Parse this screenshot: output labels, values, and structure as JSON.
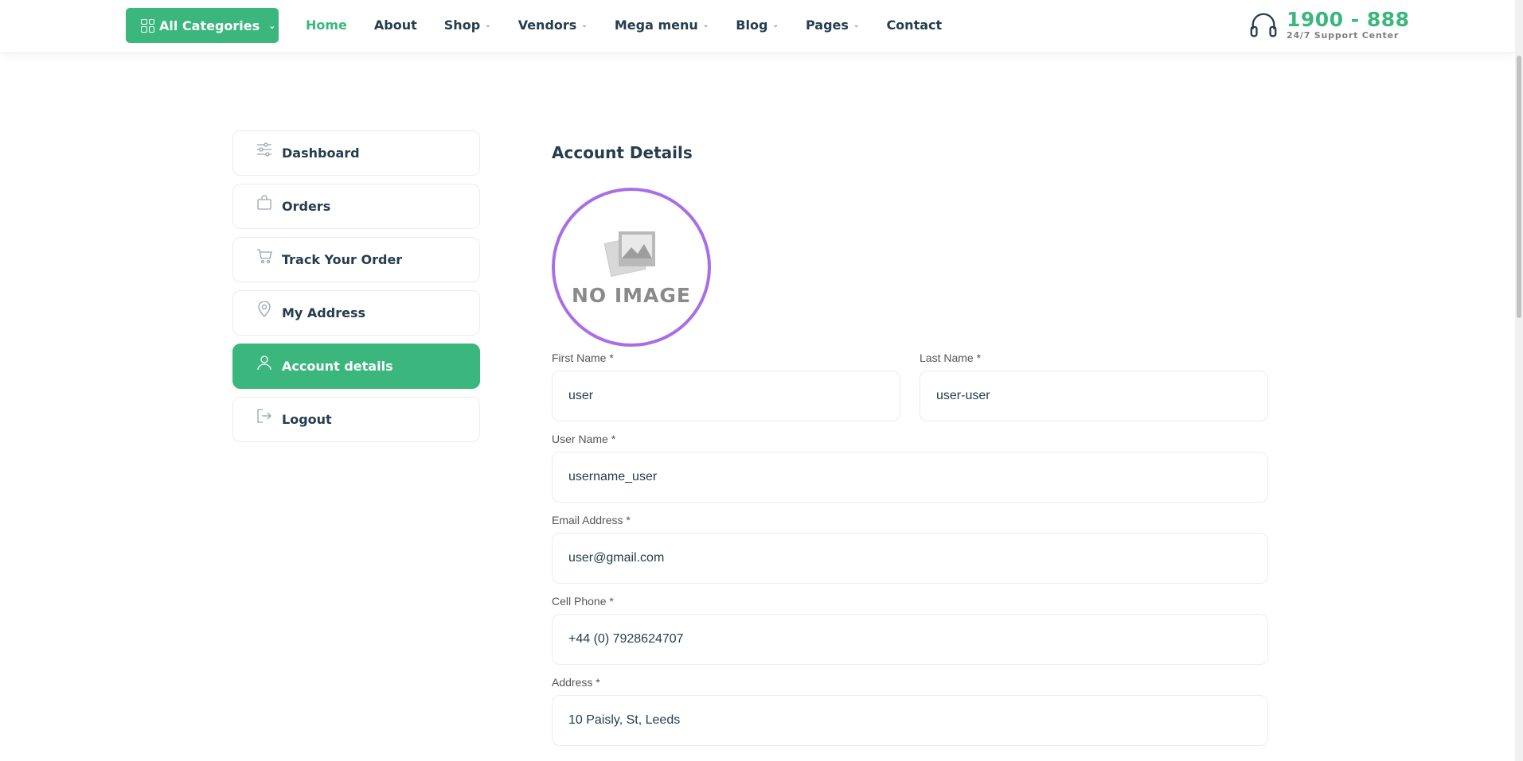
{
  "header": {
    "categories_label": "All Categories",
    "nav": [
      {
        "label": "Home",
        "active": true,
        "dropdown": false
      },
      {
        "label": "About",
        "active": false,
        "dropdown": false
      },
      {
        "label": "Shop",
        "active": false,
        "dropdown": true
      },
      {
        "label": "Vendors",
        "active": false,
        "dropdown": true
      },
      {
        "label": "Mega menu",
        "active": false,
        "dropdown": true
      },
      {
        "label": "Blog",
        "active": false,
        "dropdown": true
      },
      {
        "label": "Pages",
        "active": false,
        "dropdown": true
      },
      {
        "label": "Contact",
        "active": false,
        "dropdown": false
      }
    ],
    "support_number": "1900 - 888",
    "support_text": "24/7 Support Center"
  },
  "sidebar": {
    "items": [
      {
        "label": "Dashboard",
        "icon": "sliders-icon",
        "active": false
      },
      {
        "label": "Orders",
        "icon": "bag-icon",
        "active": false
      },
      {
        "label": "Track Your Order",
        "icon": "cart-icon",
        "active": false
      },
      {
        "label": "My Address",
        "icon": "map-pin-icon",
        "active": false
      },
      {
        "label": "Account details",
        "icon": "user-icon",
        "active": true
      },
      {
        "label": "Logout",
        "icon": "logout-icon",
        "active": false
      }
    ]
  },
  "main": {
    "title": "Account Details",
    "avatar_text": "NO IMAGE",
    "fields": {
      "first_name": {
        "label": "First Name",
        "required": "*",
        "value": "user"
      },
      "last_name": {
        "label": "Last Name",
        "required": "*",
        "value": "user-user"
      },
      "username": {
        "label": "User Name",
        "required": "*",
        "value": "username_user"
      },
      "email": {
        "label": "Email Address",
        "required": "*",
        "value": "user@gmail.com"
      },
      "phone": {
        "label": "Cell Phone",
        "required": "*",
        "value": "+44 (0) 7928624707"
      },
      "address": {
        "label": "Address",
        "required": "*",
        "value": "10 Paisly, St, Leeds"
      }
    }
  },
  "colors": {
    "accent": "#3bb77e",
    "text": "#253d4e",
    "avatar_ring": "#a96ee6"
  }
}
